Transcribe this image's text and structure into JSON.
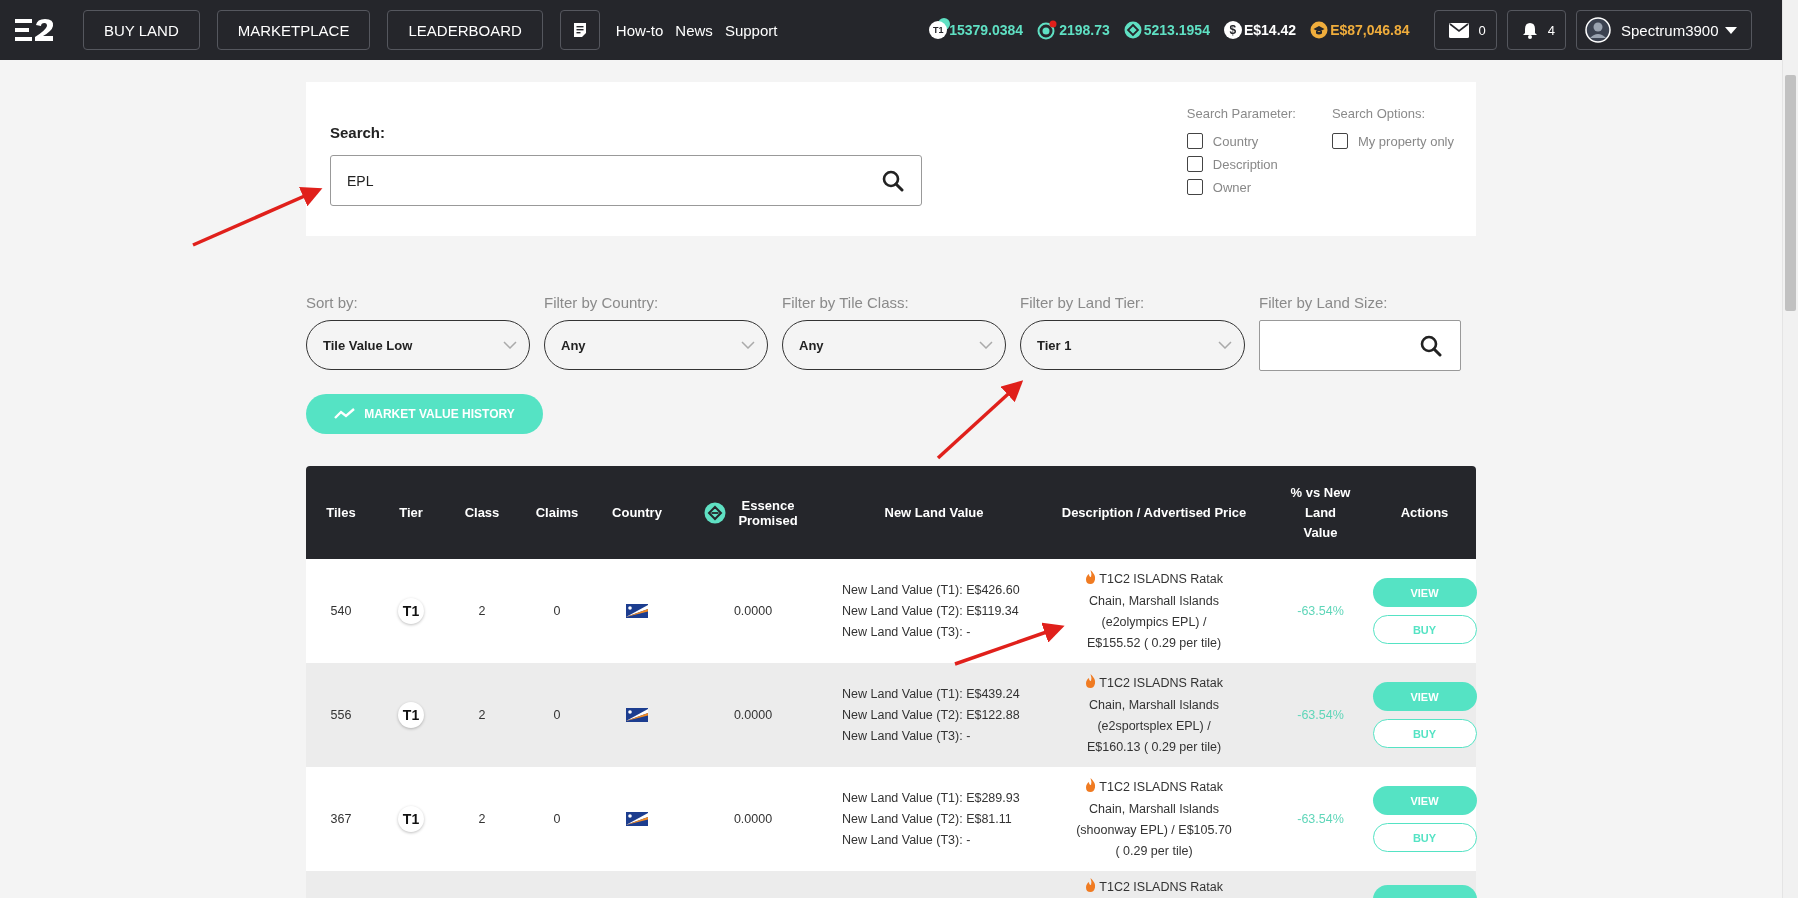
{
  "nav": {
    "buttons": [
      {
        "label": "BUY LAND"
      },
      {
        "label": "MARKETPLACE"
      },
      {
        "label": "LEADERBOARD"
      }
    ],
    "links": [
      {
        "label": "How-to"
      },
      {
        "label": "News"
      },
      {
        "label": "Support"
      }
    ]
  },
  "balances": [
    {
      "kind": "tier",
      "badge": "T1",
      "value": "15379.0384"
    },
    {
      "kind": "target",
      "value": "2198.73"
    },
    {
      "kind": "essence",
      "value": "5213.1954"
    },
    {
      "kind": "dollar",
      "badge": "$",
      "value": "E$14.42"
    },
    {
      "kind": "coin",
      "value": "E$87,046.84"
    }
  ],
  "mail_count": "0",
  "notification_count": "4",
  "user": {
    "name": "Spectrum3900"
  },
  "search": {
    "label": "Search:",
    "value": "EPL"
  },
  "search_parameters": {
    "title": "Search Parameter:",
    "options": [
      {
        "label": "Country",
        "checked": false
      },
      {
        "label": "Description",
        "checked": false
      },
      {
        "label": "Owner",
        "checked": false
      }
    ]
  },
  "search_options": {
    "title": "Search Options:",
    "options": [
      {
        "label": "My property only",
        "checked": false
      }
    ]
  },
  "filters": [
    {
      "kind": "select",
      "label": "Sort by:",
      "value": "Tile Value Low"
    },
    {
      "kind": "select",
      "label": "Filter by Country:",
      "value": "Any"
    },
    {
      "kind": "select",
      "label": "Filter by Tile Class:",
      "value": "Any"
    },
    {
      "kind": "select",
      "label": "Filter by Land Tier:",
      "value": "Tier 1"
    },
    {
      "kind": "search",
      "label": "Filter by Land Size:"
    }
  ],
  "history_button": {
    "label": "MARKET VALUE HISTORY"
  },
  "table": {
    "columns": [
      {
        "label": "Tiles"
      },
      {
        "label": "Tier"
      },
      {
        "label": "Class"
      },
      {
        "label": "Claims"
      },
      {
        "label": "Country"
      },
      {
        "label": "Essence Promised",
        "icon": true
      },
      {
        "label": "New Land Value"
      },
      {
        "label": "Description / Advertised Price"
      },
      {
        "label": "% vs New Land Value"
      },
      {
        "label": "Actions"
      }
    ],
    "rows": [
      {
        "tiles": "540",
        "tier": "T1",
        "class": "2",
        "claims": "0",
        "essence": "0.0000",
        "values": [
          "New Land Value (T1): E$426.60",
          "New Land Value (T2): E$119.34",
          "New Land Value (T3): -"
        ],
        "description": "T1C2 ISLADNS Ratak Chain, Marshall Islands (e2olympics EPL) / E$155.52 ( 0.29 per tile)",
        "change": "-63.54%",
        "actions": [
          "VIEW",
          "BUY"
        ]
      },
      {
        "tiles": "556",
        "tier": "T1",
        "class": "2",
        "claims": "0",
        "essence": "0.0000",
        "values": [
          "New Land Value (T1): E$439.24",
          "New Land Value (T2): E$122.88",
          "New Land Value (T3): -"
        ],
        "description": "T1C2 ISLADNS Ratak Chain, Marshall Islands (e2sportsplex EPL) / E$160.13 ( 0.29 per tile)",
        "change": "-63.54%",
        "actions": [
          "VIEW",
          "BUY"
        ]
      },
      {
        "tiles": "367",
        "tier": "T1",
        "class": "2",
        "claims": "0",
        "essence": "0.0000",
        "values": [
          "New Land Value (T1): E$289.93",
          "New Land Value (T2): E$81.11",
          "New Land Value (T3): -"
        ],
        "description": "T1C2 ISLADNS Ratak Chain, Marshall Islands (shoonway EPL) / E$105.70 ( 0.29 per tile)",
        "change": "-63.54%",
        "actions": [
          "VIEW",
          "BUY"
        ]
      },
      {
        "description": "T1C2 ISLADNS Ratak",
        "partial_button": true
      }
    ]
  }
}
